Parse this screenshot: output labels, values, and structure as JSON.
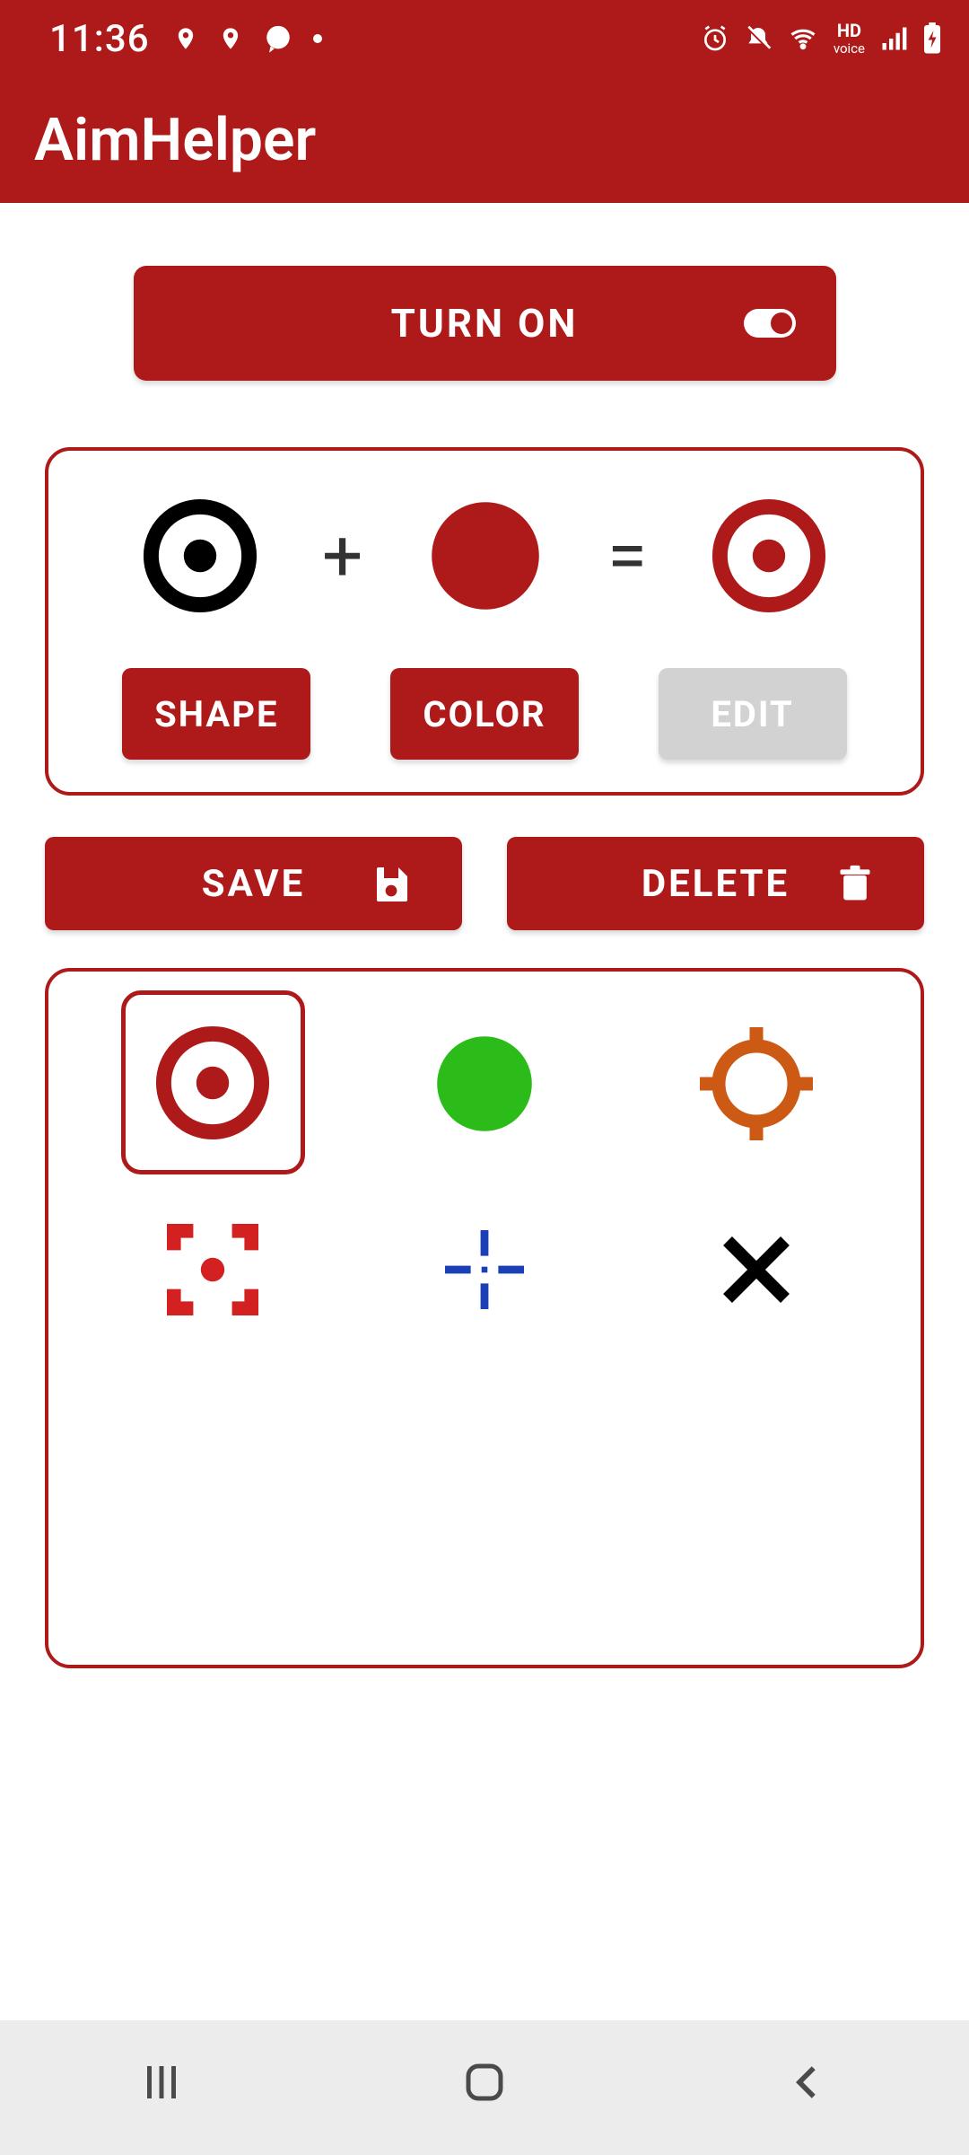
{
  "status": {
    "time": "11:36"
  },
  "app": {
    "title": "AimHelper"
  },
  "turn_on": {
    "label": "TURN ON",
    "enabled": true
  },
  "formula": {
    "plus": "+",
    "equals": "=",
    "shape": {
      "icon": "radio-black"
    },
    "color": {
      "hex": "#AE1A1A"
    },
    "result": {
      "icon": "radio-red"
    }
  },
  "config_buttons": {
    "shape": {
      "label": "SHAPE",
      "state": "active"
    },
    "color": {
      "label": "COLOR",
      "state": "active"
    },
    "edit": {
      "label": "EDIT",
      "state": "disabled"
    }
  },
  "save": {
    "label": "SAVE"
  },
  "delete": {
    "label": "DELETE"
  },
  "presets": [
    {
      "id": "radio-red",
      "selected": true
    },
    {
      "id": "solid-green",
      "selected": false
    },
    {
      "id": "reticle-orange",
      "selected": false
    },
    {
      "id": "bracket-red",
      "selected": false
    },
    {
      "id": "plus-blue",
      "selected": false
    },
    {
      "id": "x-black",
      "selected": false
    }
  ]
}
